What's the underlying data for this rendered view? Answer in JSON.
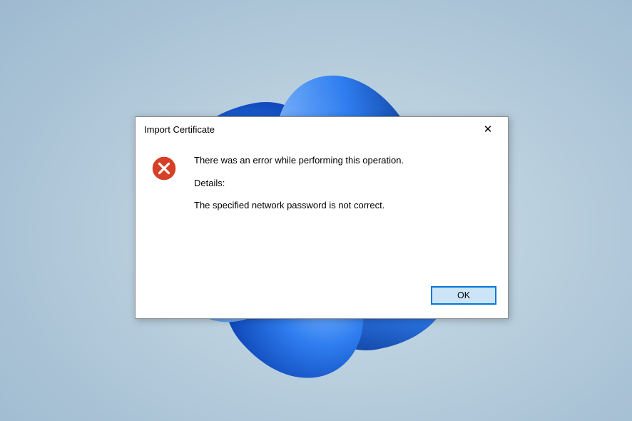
{
  "dialog": {
    "title": "Import Certificate",
    "close_label": "✕",
    "icon": "error-icon",
    "message_line1": "There was an error while performing this operation.",
    "message_line2": "Details:",
    "message_line3": "The specified network password is not correct.",
    "ok_label": "OK"
  },
  "colors": {
    "dialog_border": "#8c8c8c",
    "ok_border": "#0078d7",
    "ok_fill": "#cce4f7",
    "error_red": "#d64027"
  }
}
